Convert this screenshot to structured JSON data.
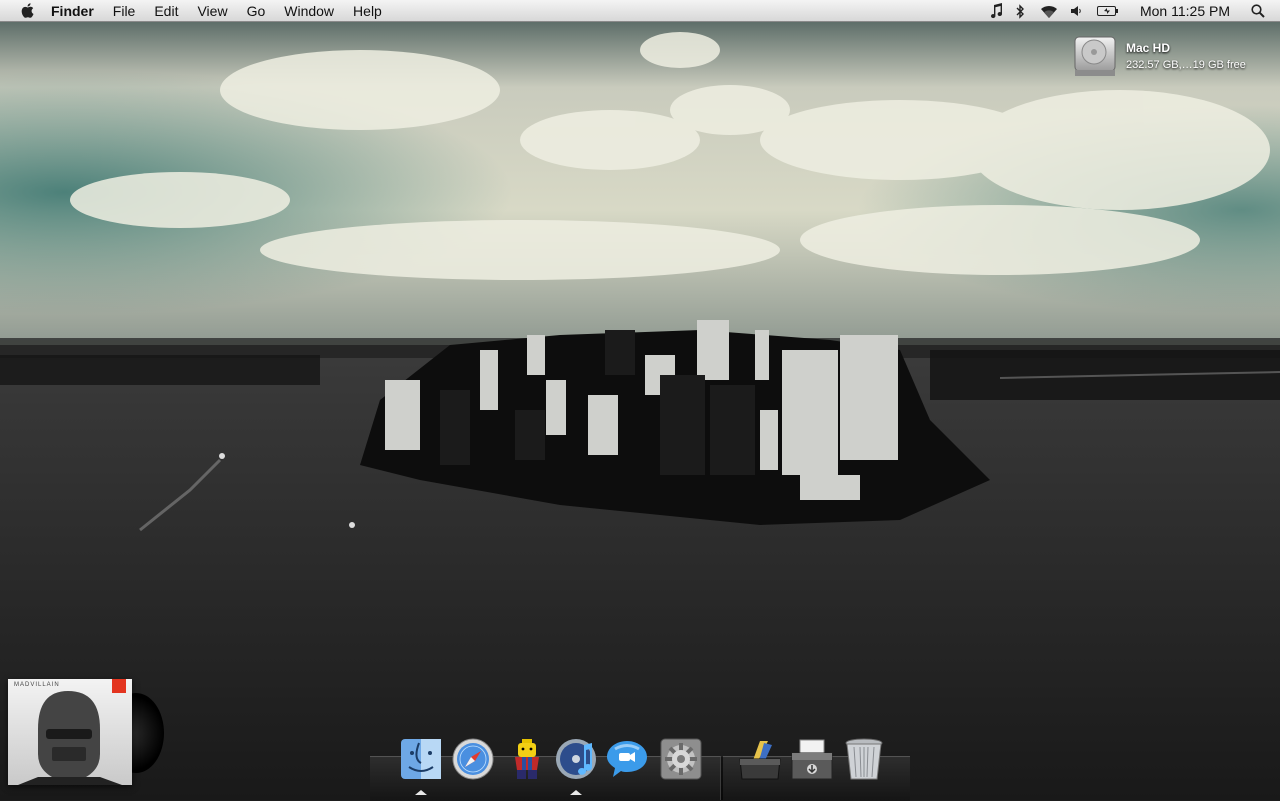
{
  "menubar": {
    "apple_icon": "apple-logo-icon",
    "active_app": "Finder",
    "menus": [
      "File",
      "Edit",
      "View",
      "Go",
      "Window",
      "Help"
    ],
    "status_icons": [
      "itunes-note-icon",
      "bluetooth-icon",
      "wifi-icon",
      "volume-icon",
      "battery-icon"
    ],
    "clock": "Mon 11:25 PM",
    "spotlight_icon": "spotlight-search-icon"
  },
  "desktop": {
    "drive": {
      "name": "Mac HD",
      "details": "232.57 GB,…19 GB free",
      "icon": "hard-drive-icon"
    }
  },
  "album_widget": {
    "label": "MADVILLAIN",
    "icon": "album-cover-icon"
  },
  "dock": {
    "apps": [
      {
        "icon": "finder-icon",
        "running": true
      },
      {
        "icon": "safari-icon",
        "running": false
      },
      {
        "icon": "lego-figure-icon",
        "running": false
      },
      {
        "icon": "itunes-icon",
        "running": true
      },
      {
        "icon": "ichat-icon",
        "running": false
      },
      {
        "icon": "system-preferences-icon",
        "running": false
      }
    ],
    "stacks": [
      {
        "icon": "applications-stack-icon"
      },
      {
        "icon": "downloads-stack-icon"
      },
      {
        "icon": "trash-icon"
      }
    ]
  },
  "colors": {
    "menubar_top": "#f4f4f4",
    "menubar_bottom": "#d8d8d8",
    "sky_teal": "#5f8c87",
    "cloud": "#e8e8d8",
    "water": "#2a2a2a"
  }
}
